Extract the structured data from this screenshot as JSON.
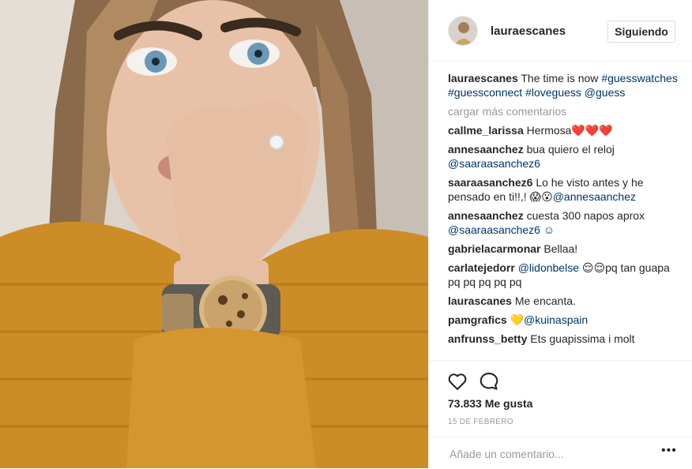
{
  "post": {
    "image_alt": "Selfie of a woman in a mustard sweater wearing a leopard-print watch",
    "username": "lauraescanes",
    "follow_button": "Siguiendo",
    "caption": {
      "user": "lauraescanes",
      "text": "The time is now",
      "tags": [
        "#guesswatches",
        "#guessconnect",
        "#loveguess"
      ],
      "mention": "@guess"
    },
    "load_more": "cargar más comentarios",
    "comments": [
      {
        "user": "callme_larissa",
        "text": "Hermosa❤️❤️❤️",
        "mention": ""
      },
      {
        "user": "annesaanchez",
        "text": "bua quiero el reloj",
        "mention": "@saaraasanchez6"
      },
      {
        "user": "saaraasanchez6",
        "text": "Lo he visto antes y he pensado en ti!!,! 😱😮",
        "mention": "@annesaanchez"
      },
      {
        "user": "annesaanchez",
        "text": "cuesta 300 napos aprox",
        "mention": "@saaraasanchez6 ☺"
      },
      {
        "user": "gabrielacarmonar",
        "text": "Bellaa!",
        "mention": ""
      },
      {
        "user": "carlatejedorr",
        "text": "",
        "mention": "@lidonbelse",
        "after": "😌😌pq tan guapa pq pq pq pq pq"
      },
      {
        "user": "laurascanes",
        "text": "Me encanta.",
        "mention": ""
      },
      {
        "user": "pamgrafics",
        "text": "💛",
        "mention": "@kuinaspain"
      },
      {
        "user": "anfrunss_betty",
        "text": "Ets guapissima i molt",
        "mention": ""
      }
    ],
    "likes": "73.833 Me gusta",
    "date": "15 DE FEBRERO",
    "add_comment_placeholder": "Añade un comentario...",
    "more_options": "•••"
  },
  "icons": {
    "like": "heart-outline-icon",
    "comment": "speech-bubble-icon",
    "options": "ellipsis-icon"
  },
  "colors": {
    "link": "#003569",
    "muted": "#999999",
    "text": "#262626",
    "border": "#efefef"
  }
}
